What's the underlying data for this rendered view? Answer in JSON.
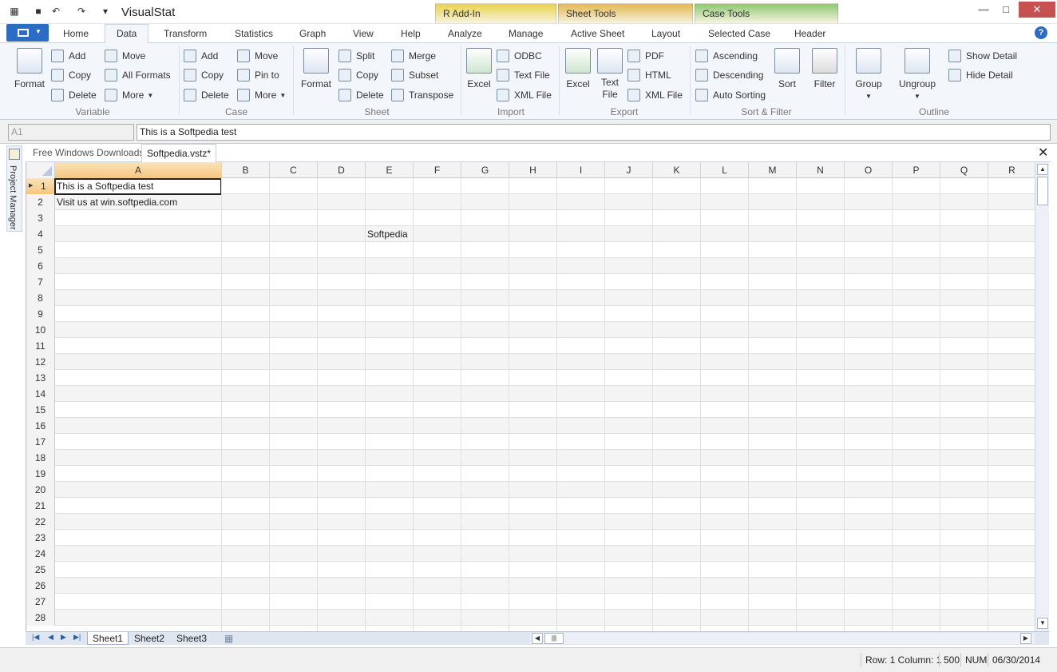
{
  "window": {
    "title": "VisualStat",
    "minimize_glyph": "—",
    "maximize_glyph": "□",
    "close_glyph": "✕"
  },
  "quick_access": {
    "save_icon": "save-icon",
    "undo_icon": "undo-icon",
    "redo_icon": "redo-icon",
    "customize_icon": "customize-icon"
  },
  "context_tabs": [
    {
      "label": "R Add-In",
      "color": "#e9d34a"
    },
    {
      "label": "Sheet Tools",
      "color": "#e3b84f"
    },
    {
      "label": "Case Tools",
      "color": "#8fc873"
    }
  ],
  "ribbon_tabs": [
    "Home",
    "Data",
    "Transform",
    "Statistics",
    "Graph",
    "View",
    "Help",
    "Analyze",
    "Manage",
    "Active Sheet",
    "Layout",
    "Selected Case",
    "Header"
  ],
  "active_tab": "Data",
  "help_glyph": "?",
  "ribbon": {
    "variable": {
      "label": "Variable",
      "format": "Format",
      "add": "Add",
      "copy": "Copy",
      "delete": "Delete",
      "move": "Move",
      "all_formats": "All Formats",
      "more": "More"
    },
    "case": {
      "label": "Case",
      "add": "Add",
      "copy": "Copy",
      "delete": "Delete",
      "move": "Move",
      "pin_to": "Pin to",
      "more": "More"
    },
    "sheet": {
      "label": "Sheet",
      "format": "Format",
      "split": "Split",
      "copy": "Copy",
      "delete": "Delete",
      "merge": "Merge",
      "subset": "Subset",
      "transpose": "Transpose"
    },
    "import": {
      "label": "Import",
      "excel": "Excel",
      "odbc": "ODBC",
      "text_file": "Text File",
      "xml_file": "XML File"
    },
    "export": {
      "label": "Export",
      "excel": "Excel",
      "text": "Text",
      "file": "File",
      "pdf": "PDF",
      "html": "HTML",
      "xml_file": "XML File"
    },
    "sort_filter": {
      "label": "Sort & Filter",
      "ascending": "Ascending",
      "descending": "Descending",
      "auto_sorting": "Auto Sorting",
      "sort": "Sort",
      "filter": "Filter"
    },
    "outline": {
      "label": "Outline",
      "group": "Group",
      "ungroup": "Ungroup",
      "show_detail": "Show Detail",
      "hide_detail": "Hide Detail"
    }
  },
  "formula_bar": {
    "name_box": "A1",
    "content": "This is a Softpedia test"
  },
  "side_panel": {
    "label": "Project Manager"
  },
  "doc_tabs": {
    "inactive": "Free Windows Downloads",
    "active": "Softpedia.vstz*",
    "close_glyph": "✕"
  },
  "grid": {
    "columns": [
      "A",
      "B",
      "C",
      "D",
      "E",
      "F",
      "G",
      "H",
      "I",
      "J",
      "K",
      "L",
      "M",
      "N",
      "O",
      "P",
      "Q",
      "R"
    ],
    "rows": [
      "1",
      "2",
      "3",
      "4",
      "5",
      "6",
      "7",
      "8",
      "9",
      "10",
      "11",
      "12",
      "13",
      "14",
      "15",
      "16",
      "17",
      "18",
      "19",
      "20",
      "21",
      "22",
      "23",
      "24",
      "25",
      "26",
      "27",
      "28"
    ],
    "cells": {
      "A1": "This is a Softpedia test",
      "A2": "Visit us at win.softpedia.com",
      "E4": "Softpedia"
    },
    "selected_cell": "A1"
  },
  "sheet_tabs": [
    "Sheet1",
    "Sheet2",
    "Sheet3"
  ],
  "active_sheet": "Sheet1",
  "status": {
    "position": "Row: 1 Column: 1",
    "count": "500",
    "num": "NUM",
    "date": "06/30/2014"
  }
}
